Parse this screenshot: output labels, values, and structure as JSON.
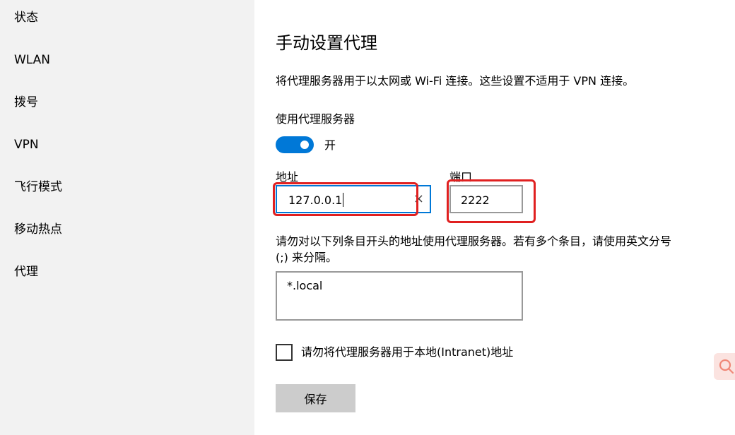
{
  "sidebar": {
    "items": [
      {
        "label": "状态"
      },
      {
        "label": "WLAN"
      },
      {
        "label": "拨号"
      },
      {
        "label": "VPN"
      },
      {
        "label": "飞行模式"
      },
      {
        "label": "移动热点"
      },
      {
        "label": "代理"
      }
    ]
  },
  "main": {
    "title": "手动设置代理",
    "description": "将代理服务器用于以太网或 Wi-Fi 连接。这些设置不适用于 VPN 连接。",
    "use_proxy_label": "使用代理服务器",
    "toggle_state": "开",
    "toggle_on": true,
    "address": {
      "label": "地址",
      "value": "127.0.0.1",
      "clear_glyph": "×"
    },
    "port": {
      "label": "端口",
      "value": "2222"
    },
    "exceptions": {
      "description": "请勿对以下列条目开头的地址使用代理服务器。若有多个条目，请使用英文分号 (;) 来分隔。",
      "value": "*.local"
    },
    "bypass_local": {
      "label": "请勿将代理服务器用于本地(Intranet)地址",
      "checked": false
    },
    "save_label": "保存"
  },
  "colors": {
    "accent": "#0078d7",
    "annotation": "#e02020",
    "sidebar_bg": "#f2f2f2",
    "button_bg": "#cccccc"
  },
  "icons": {
    "float_button": "search-icon"
  }
}
